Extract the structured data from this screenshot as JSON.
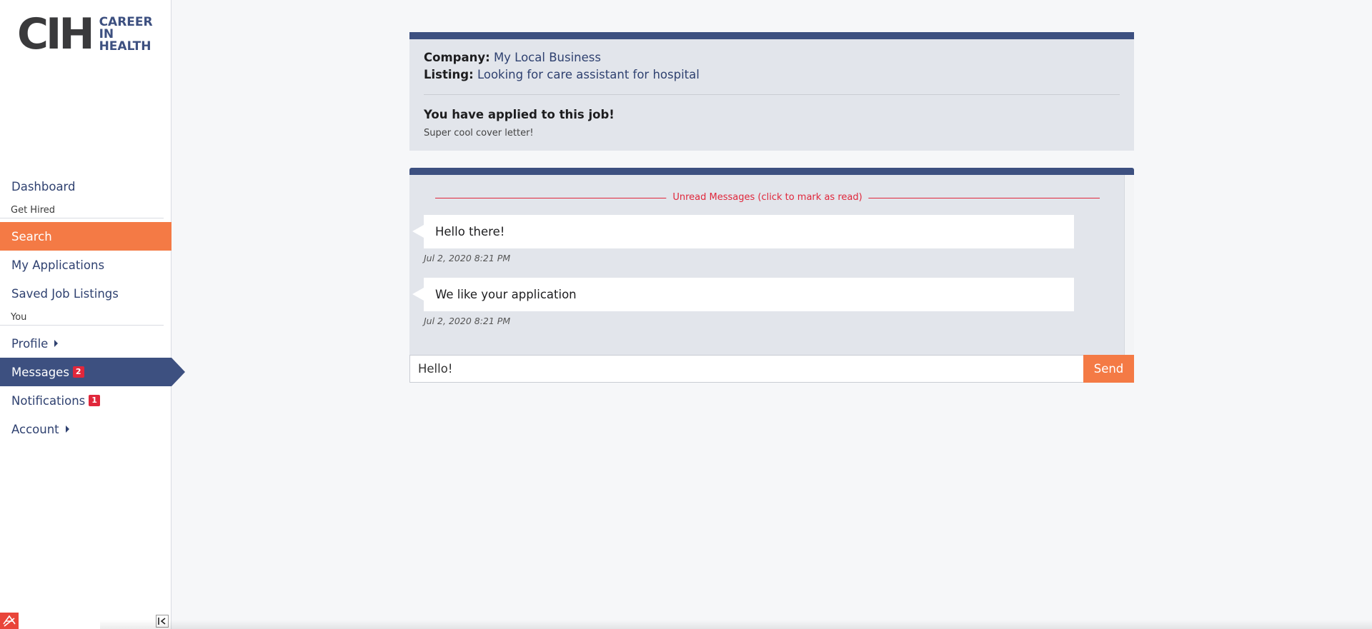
{
  "logo": {
    "mark": "CIH",
    "line1": "CAREER",
    "line2": "IN",
    "line3": "HEALTH"
  },
  "sidebar": {
    "items": [
      {
        "type": "link",
        "label": "Dashboard"
      },
      {
        "type": "section",
        "label": "Get Hired"
      },
      {
        "type": "link",
        "label": "Search",
        "active": true
      },
      {
        "type": "link",
        "label": "My Applications"
      },
      {
        "type": "link",
        "label": "Saved Job Listings"
      },
      {
        "type": "section",
        "label": "You"
      },
      {
        "type": "link",
        "label": "Profile",
        "expandable": true
      },
      {
        "type": "link",
        "label": "Messages",
        "badge": "2",
        "current": true
      },
      {
        "type": "link",
        "label": "Notifications",
        "badge": "1"
      },
      {
        "type": "link",
        "label": "Account",
        "expandable": true
      }
    ]
  },
  "info": {
    "company_label": "Company:",
    "company_value": "My Local Business",
    "listing_label": "Listing:",
    "listing_value": "Looking for care assistant for hospital",
    "applied_title": "You have applied to this job!",
    "cover_letter": "Super cool cover letter!"
  },
  "messages": {
    "unread_label": "Unread Messages (click to mark as read)",
    "items": [
      {
        "text": "Hello there!",
        "time": "Jul 2, 2020 8:21 PM"
      },
      {
        "text": "We like your application",
        "time": "Jul 2, 2020 8:21 PM"
      }
    ]
  },
  "composer": {
    "value": "Hello!",
    "send_label": "Send"
  },
  "colors": {
    "brand_navy": "#3d5080",
    "accent_orange": "#f47a45",
    "alert_red": "#e0273b"
  }
}
